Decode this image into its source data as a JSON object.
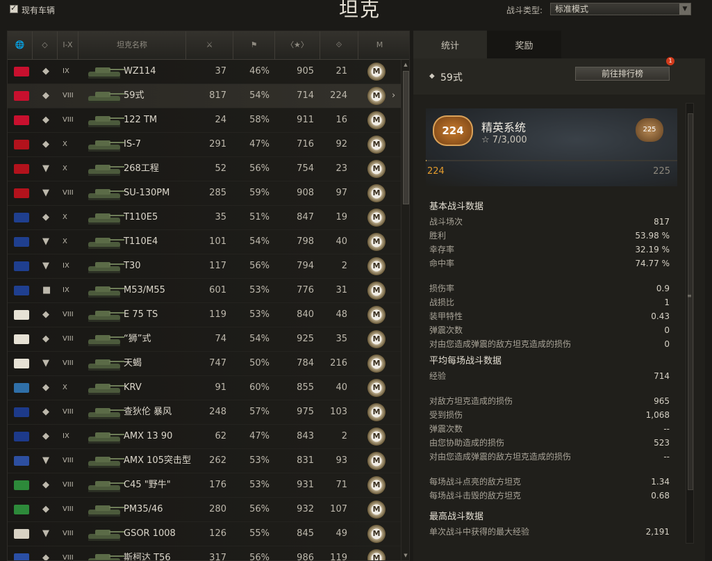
{
  "window_title": "坦克",
  "filters": {
    "owned_label": "现有车辆",
    "battle_type_label": "战斗类型:",
    "battle_type_value": "标准模式"
  },
  "columns": {
    "nation": "🌐",
    "class": "◇",
    "tier": "I-X",
    "name": "坦克名称",
    "battles": "⚔",
    "winrate": "⚑",
    "xp": "〈★〉",
    "damage": "⟐",
    "mastery": "M"
  },
  "tanks": [
    {
      "nation": "china",
      "class": "◆",
      "tier": "IX",
      "name": "WZ114",
      "battles": "37",
      "winrate": "46%",
      "xp": "905",
      "damage": "21"
    },
    {
      "nation": "china",
      "class": "◆",
      "tier": "VIII",
      "name": "59式",
      "battles": "817",
      "winrate": "54%",
      "xp": "714",
      "damage": "224",
      "selected": true
    },
    {
      "nation": "china",
      "class": "◆",
      "tier": "VIII",
      "name": "122 TM",
      "battles": "24",
      "winrate": "58%",
      "xp": "911",
      "damage": "16"
    },
    {
      "nation": "ussr",
      "class": "◆",
      "tier": "X",
      "name": "IS-7",
      "battles": "291",
      "winrate": "47%",
      "xp": "716",
      "damage": "92"
    },
    {
      "nation": "ussr",
      "class": "▼",
      "tier": "X",
      "name": "268工程",
      "battles": "52",
      "winrate": "56%",
      "xp": "754",
      "damage": "23"
    },
    {
      "nation": "ussr",
      "class": "▼",
      "tier": "VIII",
      "name": "SU-130PM",
      "battles": "285",
      "winrate": "59%",
      "xp": "908",
      "damage": "97"
    },
    {
      "nation": "usa",
      "class": "◆",
      "tier": "X",
      "name": "T110E5",
      "battles": "35",
      "winrate": "51%",
      "xp": "847",
      "damage": "19"
    },
    {
      "nation": "usa",
      "class": "▼",
      "tier": "X",
      "name": "T110E4",
      "battles": "101",
      "winrate": "54%",
      "xp": "798",
      "damage": "40"
    },
    {
      "nation": "usa",
      "class": "▼",
      "tier": "IX",
      "name": "T30",
      "battles": "117",
      "winrate": "56%",
      "xp": "794",
      "damage": "2"
    },
    {
      "nation": "usa",
      "class": "■",
      "tier": "IX",
      "name": "M53/M55",
      "battles": "601",
      "winrate": "53%",
      "xp": "776",
      "damage": "31"
    },
    {
      "nation": "germany",
      "class": "◆",
      "tier": "VIII",
      "name": "E 75 TS",
      "battles": "119",
      "winrate": "53%",
      "xp": "840",
      "damage": "48"
    },
    {
      "nation": "germany",
      "class": "◆",
      "tier": "VIII",
      "name": "“狮”式",
      "battles": "74",
      "winrate": "54%",
      "xp": "925",
      "damage": "35"
    },
    {
      "nation": "germany",
      "class": "▼",
      "tier": "VIII",
      "name": "天蝎",
      "battles": "747",
      "winrate": "50%",
      "xp": "784",
      "damage": "216"
    },
    {
      "nation": "sweden",
      "class": "◆",
      "tier": "X",
      "name": "KRV",
      "battles": "91",
      "winrate": "60%",
      "xp": "855",
      "damage": "40"
    },
    {
      "nation": "uk",
      "class": "◆",
      "tier": "VIII",
      "name": "查狄伦 暴风",
      "battles": "248",
      "winrate": "57%",
      "xp": "975",
      "damage": "103"
    },
    {
      "nation": "uk",
      "class": "◆",
      "tier": "IX",
      "name": "AMX 13 90",
      "battles": "62",
      "winrate": "47%",
      "xp": "843",
      "damage": "2"
    },
    {
      "nation": "france",
      "class": "▼",
      "tier": "VIII",
      "name": "AMX 105突击型",
      "battles": "262",
      "winrate": "53%",
      "xp": "831",
      "damage": "93"
    },
    {
      "nation": "italy",
      "class": "◆",
      "tier": "VIII",
      "name": "C45 \"野牛\"",
      "battles": "176",
      "winrate": "53%",
      "xp": "931",
      "damage": "71"
    },
    {
      "nation": "italy",
      "class": "◆",
      "tier": "VIII",
      "name": "PM35/46",
      "battles": "280",
      "winrate": "56%",
      "xp": "932",
      "damage": "107"
    },
    {
      "nation": "japan",
      "class": "▼",
      "tier": "VIII",
      "name": "GSOR 1008",
      "battles": "126",
      "winrate": "55%",
      "xp": "845",
      "damage": "49"
    },
    {
      "nation": "czech",
      "class": "◆",
      "tier": "VIII",
      "name": "斯柯达 T56",
      "battles": "317",
      "winrate": "56%",
      "xp": "986",
      "damage": "119"
    }
  ],
  "tabs": {
    "stats": "统计",
    "awards": "奖励"
  },
  "detail": {
    "class": "◆",
    "tank_name": "59式",
    "leaderboard_button": "前往排行榜",
    "notif_count": "1",
    "elite_title": "精英系统",
    "elite_progress": "7/3,000",
    "elite_level": "224",
    "elite_next_level": "225",
    "elite_progress_fraction": 0.0023
  },
  "stats": {
    "basic_header": "基本战斗数据",
    "battles_label": "战斗场次",
    "battles": "817",
    "wins_label": "胜利",
    "wins": "53.98 %",
    "survival_label": "幸存率",
    "survival": "32.19 %",
    "hit_label": "命中率",
    "hit": "74.77 %",
    "dmg_ratio_label": "损伤率",
    "dmg_ratio": "0.9",
    "kd_label": "战损比",
    "kd": "1",
    "armor_label": "装甲特性",
    "armor": "0.43",
    "stun_label": "弹震次数",
    "stun": "0",
    "stun_dmg_label": "对由您造成弹震的敌方坦克造成的损伤",
    "stun_dmg": "0",
    "avg_header": "平均每场战斗数据",
    "xp_label": "经验",
    "xp": "714",
    "dealt_label": "对敌方坦克造成的损伤",
    "dealt": "965",
    "taken_label": "受到损伤",
    "taken": "1,068",
    "avg_stun_label": "弹震次数",
    "avg_stun": "--",
    "assist_label": "由您协助造成的损伤",
    "assist": "523",
    "avg_stun_dmg_label": "对由您造成弹震的敌方坦克造成的损伤",
    "avg_stun_dmg": "--",
    "spotted_label": "每场战斗点亮的敌方坦克",
    "spotted": "1.34",
    "killed_label": "每场战斗击毁的敌方坦克",
    "killed": "0.68",
    "max_header": "最高战斗数据",
    "max_xp_label": "单次战斗中获得的最大经验",
    "max_xp": "2,191"
  }
}
